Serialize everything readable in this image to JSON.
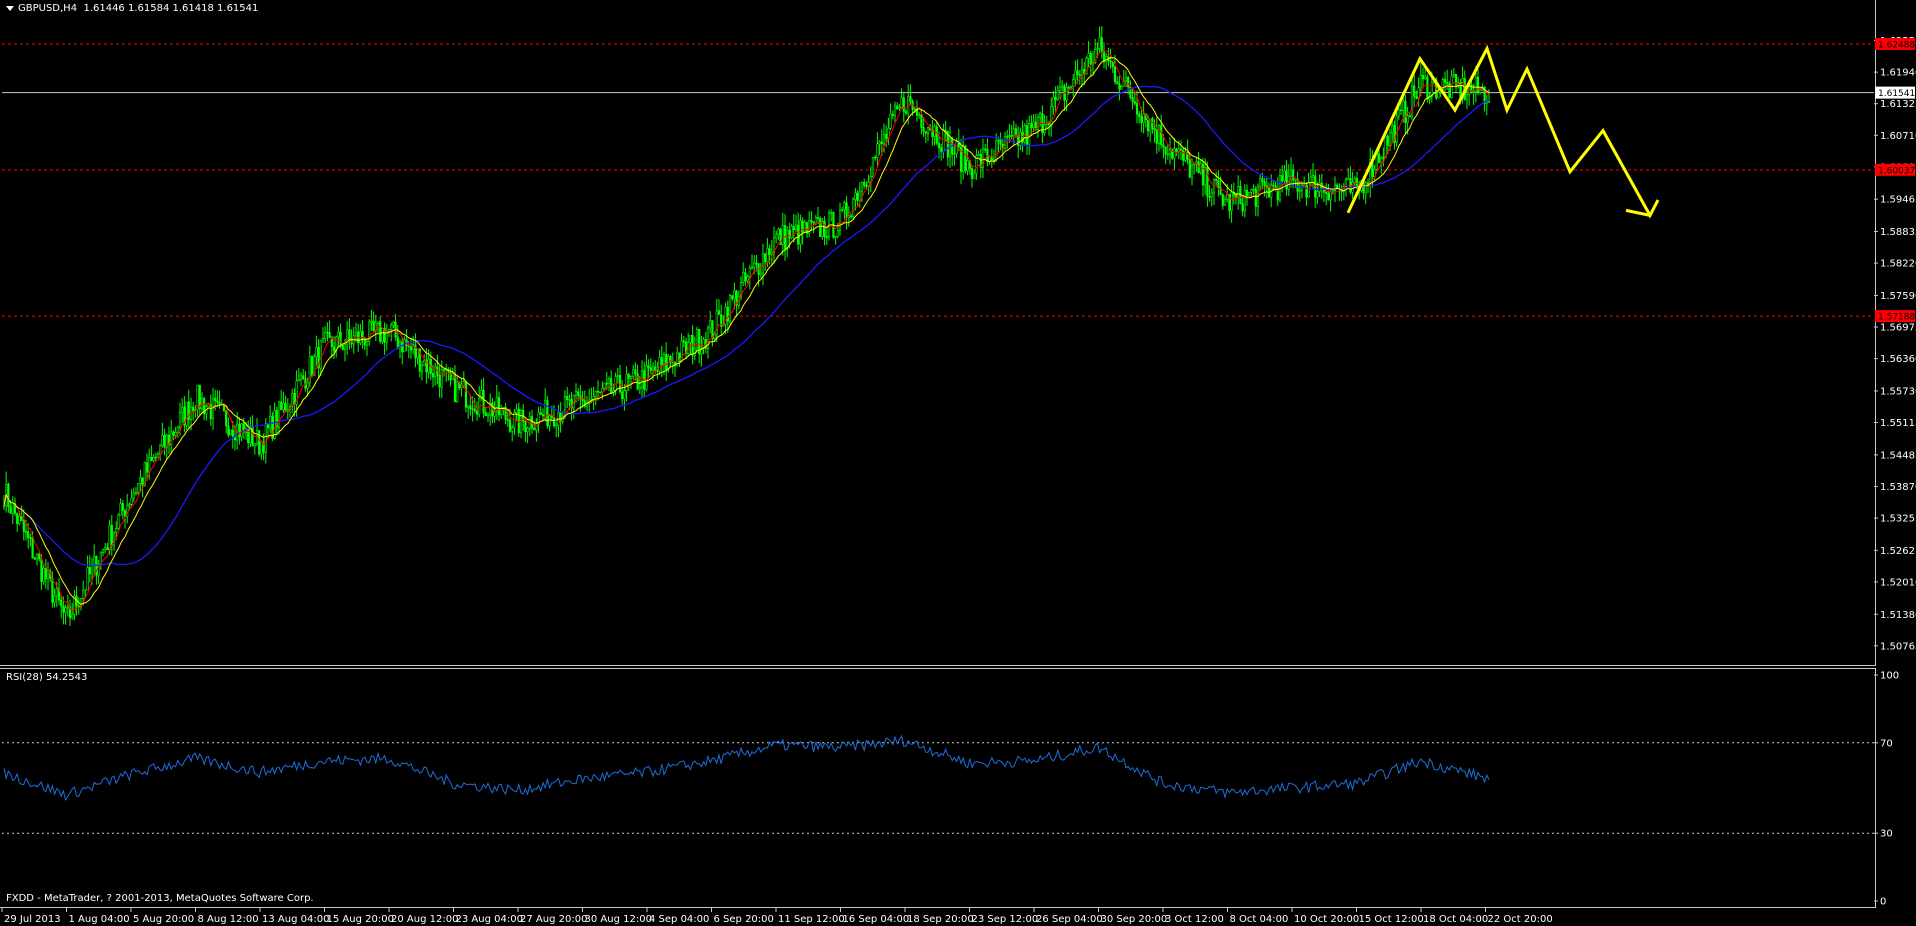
{
  "header": {
    "symbol": "GBPUSD,H4",
    "ohlc": "1.61446 1.61584 1.61418 1.61541"
  },
  "rsi": {
    "label": "RSI(28) 54.2543",
    "levels": [
      "100",
      "70",
      "30",
      "0"
    ]
  },
  "footer": {
    "copyright": "FXDD - MetaTrader, ? 2001-2013, MetaQuotes Software Corp."
  },
  "price_axis": {
    "ticks": [
      "1.62555",
      "1.61940",
      "1.61325",
      "1.60710",
      "1.60095",
      "1.59465",
      "1.58835",
      "1.58220",
      "1.57590",
      "1.56975",
      "1.56360",
      "1.55730",
      "1.55115",
      "1.54485",
      "1.53870",
      "1.53255",
      "1.52625",
      "1.52010",
      "1.51380",
      "1.50765"
    ],
    "current_price": "1.61541",
    "resistance_tag": "1.62488",
    "mid_tag": "1.60037",
    "support_tag": "1.57188"
  },
  "time_axis": {
    "labels": [
      "29 Jul 2013",
      "1 Aug 04:00",
      "5 Aug 20:00",
      "8 Aug 12:00",
      "13 Aug 04:00",
      "15 Aug 20:00",
      "20 Aug 12:00",
      "23 Aug 04:00",
      "27 Aug 20:00",
      "30 Aug 12:00",
      "4 Sep 04:00",
      "6 Sep 20:00",
      "11 Sep 12:00",
      "16 Sep 04:00",
      "18 Sep 20:00",
      "23 Sep 12:00",
      "26 Sep 04:00",
      "30 Sep 20:00",
      "3 Oct 12:00",
      "8 Oct 04:00",
      "10 Oct 20:00",
      "15 Oct 12:00",
      "18 Oct 04:00",
      "22 Oct 20:00"
    ]
  },
  "colors": {
    "background": "#000000",
    "bull": "#00ff00",
    "bear": "#00ff00",
    "ma_fast": "#ffff00",
    "ma_mid": "#ff0000",
    "ma_slow": "#1a1aff",
    "rsi_line": "#1e6fd9",
    "level_line": "#ff0000",
    "projection": "#ffff00"
  },
  "chart_data": {
    "type": "candlestick",
    "symbol": "GBPUSD",
    "timeframe": "H4",
    "ylim": [
      1.5045,
      1.6315
    ],
    "key_points": [
      {
        "x": "29 Jul 2013",
        "y": 1.5385
      },
      {
        "x": "1 Aug 04:00",
        "y": 1.5125
      },
      {
        "x": "5 Aug 20:00",
        "y": 1.537
      },
      {
        "x": "8 Aug 12:00",
        "y": 1.556
      },
      {
        "x": "13 Aug 04:00",
        "y": 1.547
      },
      {
        "x": "15 Aug 20:00",
        "y": 1.566
      },
      {
        "x": "20 Aug 12:00",
        "y": 1.569
      },
      {
        "x": "23 Aug 04:00",
        "y": 1.558
      },
      {
        "x": "27 Aug 20:00",
        "y": 1.551
      },
      {
        "x": "30 Aug 12:00",
        "y": 1.555
      },
      {
        "x": "4 Sep 04:00",
        "y": 1.56
      },
      {
        "x": "6 Sep 20:00",
        "y": 1.569
      },
      {
        "x": "11 Sep 12:00",
        "y": 1.587
      },
      {
        "x": "16 Sep 04:00",
        "y": 1.59
      },
      {
        "x": "18 Sep 20:00",
        "y": 1.614
      },
      {
        "x": "23 Sep 12:00",
        "y": 1.601
      },
      {
        "x": "26 Sep 04:00",
        "y": 1.608
      },
      {
        "x": "30 Sep 20:00",
        "y": 1.624
      },
      {
        "x": "3 Oct 12:00",
        "y": 1.606
      },
      {
        "x": "8 Oct 04:00",
        "y": 1.594
      },
      {
        "x": "10 Oct 20:00",
        "y": 1.598
      },
      {
        "x": "15 Oct 12:00",
        "y": 1.596
      },
      {
        "x": "18 Oct 04:00",
        "y": 1.617
      },
      {
        "x": "22 Oct 20:00",
        "y": 1.6154
      }
    ],
    "horizontal_levels": [
      1.62488,
      1.61541,
      1.60037,
      1.57188
    ],
    "projection_path": [
      1.592,
      1.622,
      1.612,
      1.624,
      1.612,
      1.62,
      1.6,
      1.608,
      1.5915,
      1.5945
    ],
    "rsi": {
      "period": 28,
      "current": 54.2543,
      "ylim": [
        0,
        100
      ],
      "levels": [
        70,
        30
      ],
      "key_points": [
        {
          "x": "29 Jul 2013",
          "y": 57
        },
        {
          "x": "1 Aug 04:00",
          "y": 47
        },
        {
          "x": "5 Aug 20:00",
          "y": 56
        },
        {
          "x": "8 Aug 12:00",
          "y": 63
        },
        {
          "x": "13 Aug 04:00",
          "y": 57
        },
        {
          "x": "15 Aug 20:00",
          "y": 62
        },
        {
          "x": "20 Aug 12:00",
          "y": 63
        },
        {
          "x": "23 Aug 04:00",
          "y": 52
        },
        {
          "x": "27 Aug 20:00",
          "y": 49
        },
        {
          "x": "30 Aug 12:00",
          "y": 54
        },
        {
          "x": "4 Sep 04:00",
          "y": 57
        },
        {
          "x": "6 Sep 20:00",
          "y": 62
        },
        {
          "x": "11 Sep 12:00",
          "y": 69
        },
        {
          "x": "16 Sep 04:00",
          "y": 68
        },
        {
          "x": "18 Sep 20:00",
          "y": 71
        },
        {
          "x": "23 Sep 12:00",
          "y": 61
        },
        {
          "x": "26 Sep 04:00",
          "y": 62
        },
        {
          "x": "30 Sep 20:00",
          "y": 68
        },
        {
          "x": "3 Oct 12:00",
          "y": 52
        },
        {
          "x": "8 Oct 04:00",
          "y": 48
        },
        {
          "x": "10 Oct 20:00",
          "y": 50
        },
        {
          "x": "15 Oct 12:00",
          "y": 52
        },
        {
          "x": "18 Oct 04:00",
          "y": 62
        },
        {
          "x": "22 Oct 20:00",
          "y": 54
        }
      ]
    }
  }
}
